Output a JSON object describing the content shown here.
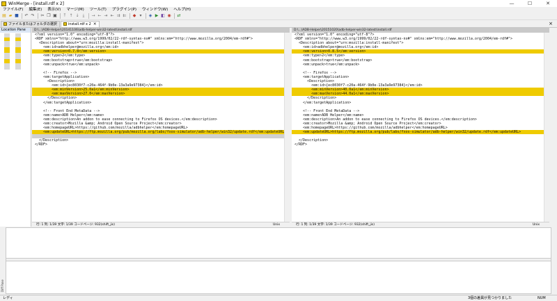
{
  "window": {
    "title": "WinMerge - [install.rdf x 2]",
    "minimize": "—",
    "maximize": "☐",
    "close": "✕"
  },
  "menu": [
    "ファイル(F)",
    "編集(E)",
    "表示(V)",
    "マージ(M)",
    "ツール(T)",
    "プラグイン(P)",
    "ウィンドウ(W)",
    "ヘルプ(H)"
  ],
  "tabs": [
    {
      "label": "ファイルまたはフォルダの選択"
    },
    {
      "label": "install.rdf x 2",
      "close": "×"
    }
  ],
  "tabbar_close": "×",
  "location_pane": {
    "title": "Location Pane"
  },
  "colors": {
    "diff": "#efcb00",
    "highlight": "#ffec80",
    "ghost": "#d0d0d0"
  },
  "left": {
    "path": "D:\\...\\ADB-Helper\\20141106\\adb-helper-win32-latest\\install.rdf",
    "lines": [
      {
        "text": "<?xml version=\"1.0\" encoding=\"utf-8\"?>",
        "type": "normal"
      },
      {
        "text": "<RDF xmlns=\"http://www.w3.org/1999/02/22-rdf-syntax-ns#\" xmlns:em=\"http://www.mozilla.org/2004/em-rdf#\">",
        "type": "normal"
      },
      {
        "text": "  <Description about=\"urn:mozilla:install-manifest\">",
        "type": "normal"
      },
      {
        "text": "    <em:id>adbhelper@mozilla.org</em:id>",
        "type": "normal"
      },
      {
        "text": "    <em:version>0.7.0</em:version>",
        "type": "diff"
      },
      {
        "text": "    <em:type>2</em:type>",
        "type": "normal"
      },
      {
        "text": "    <em:bootstrap>true</em:bootstrap>",
        "type": "normal"
      },
      {
        "text": "    <em:unpack>true</em:unpack>",
        "type": "normal"
      },
      {
        "text": "",
        "type": "normal"
      },
      {
        "text": "    <!-- Firefox -->",
        "type": "normal"
      },
      {
        "text": "    <em:targetApplication>",
        "type": "normal"
      },
      {
        "text": "      <Description>",
        "type": "normal"
      },
      {
        "text": "        <em:id>{ec8030f7-c20a-464f-9b0e-13a3a9e97384}</em:id>",
        "type": "normal"
      },
      {
        "text": "        <em:minVersion>25.0a1</em:minVersion>",
        "type": "diff"
      },
      {
        "text": "        <em:maxVersion>27.0</em:maxVersion>",
        "type": "diff"
      },
      {
        "text": "      </Description>",
        "type": "normal"
      },
      {
        "text": "    </em:targetApplication>",
        "type": "normal"
      },
      {
        "text": "",
        "type": "normal"
      },
      {
        "text": "    <!-- Front End MetaData -->",
        "type": "normal"
      },
      {
        "text": "    <em:name>ADB Helper</em:name>",
        "type": "normal"
      },
      {
        "text": "    <em:description>An addon to ease connecting to Firefox OS devices.</em:description>",
        "type": "normal"
      },
      {
        "text": "    <em:creator>Mozilla &amp; Android Open Source Project</em:creator>",
        "type": "normal"
      },
      {
        "text": "    <em:homepageURL>https://github.com/mozilla/adbhelper</em:homepageURL>",
        "type": "normal"
      },
      {
        "text": "    <em:updateURL>https://ftp.mozilla.org/pub/mozilla.org/labs/fxos-simulator/adb-helper/win32/update.rdf</em:updateURL>",
        "type": "diff"
      },
      {
        "text": "",
        "type": "ghost"
      },
      {
        "text": "  </Description>",
        "type": "normal"
      },
      {
        "text": "</RDF>",
        "type": "normal"
      }
    ],
    "status": "行: 1 列: 1/39 文字: 1/39 コードページ: 932(shift_jis)",
    "eol": "Unix"
  },
  "right": {
    "path": "D:\\...\\ADB-Helper\\20151020\\adb-helper-win32-latest\\install.rdf",
    "lines": [
      {
        "text": "<?xml version=\"1.0\" encoding=\"utf-8\"?>",
        "type": "normal"
      },
      {
        "text": "<RDF xmlns=\"http://www.w3.org/1999/02/22-rdf-syntax-ns#\" xmlns:em=\"http://www.mozilla.org/2004/em-rdf#\">",
        "type": "normal"
      },
      {
        "text": "  <Description about=\"urn:mozilla:install-manifest\">",
        "type": "normal"
      },
      {
        "text": "    <em:id>adbhelper@mozilla.org</em:id>",
        "type": "normal"
      },
      {
        "text": "    <em:version>0.8.5</em:version>",
        "type": "diff"
      },
      {
        "text": "    <em:type>2</em:type>",
        "type": "normal"
      },
      {
        "text": "    <em:bootstrap>true</em:bootstrap>",
        "type": "normal"
      },
      {
        "text": "    <em:unpack>true</em:unpack>",
        "type": "normal"
      },
      {
        "text": "",
        "type": "normal"
      },
      {
        "text": "    <!-- Firefox -->",
        "type": "normal"
      },
      {
        "text": "    <em:targetApplication>",
        "type": "normal"
      },
      {
        "text": "      <Description>",
        "type": "normal"
      },
      {
        "text": "        <em:id>{ec8030f7-c20a-464f-9b0e-13a3a9e97384}</em:id>",
        "type": "normal"
      },
      {
        "text": "        <em:minVersion>40.0a1</em:minVersion>",
        "type": "diff"
      },
      {
        "text": "        <em:maxVersion>44.0a1</em:maxVersion>",
        "type": "diff"
      },
      {
        "text": "      </Description>",
        "type": "normal"
      },
      {
        "text": "    </em:targetApplication>",
        "type": "normal"
      },
      {
        "text": "",
        "type": "normal"
      },
      {
        "text": "    <!-- Front End MetaData -->",
        "type": "normal"
      },
      {
        "text": "    <em:name>ADB Helper</em:name>",
        "type": "normal"
      },
      {
        "text": "    <em:description>An addon to ease connecting to Firefox OS devices.</em:description>",
        "type": "normal"
      },
      {
        "text": "    <em:creator>Mozilla &amp; Android Open Source Project</em:creator>",
        "type": "normal"
      },
      {
        "text": "    <em:homepageURL>https://github.com/mozilla/adbhelper</em:homepageURL>",
        "type": "normal"
      },
      {
        "text": "    <em:updateURL>https://ftp.mozilla.org/pub/labs/fxos-simulator/adb-helper/win32/update.rdf</em:updateURL>",
        "type": "diff"
      },
      {
        "text": "",
        "type": "normal"
      },
      {
        "text": "  </Description>",
        "type": "normal"
      },
      {
        "text": "</RDF>",
        "type": "normal"
      }
    ],
    "status": "行: 1 列: 1/39 文字: 1/39 コードページ: 932(shift_jis)",
    "eol": "Unix"
  },
  "diff_pane_label": "Diff Pane",
  "statusbar": {
    "ready": "レディ",
    "diffs": "3個の差異が見つかりました",
    "num": "NUM"
  }
}
